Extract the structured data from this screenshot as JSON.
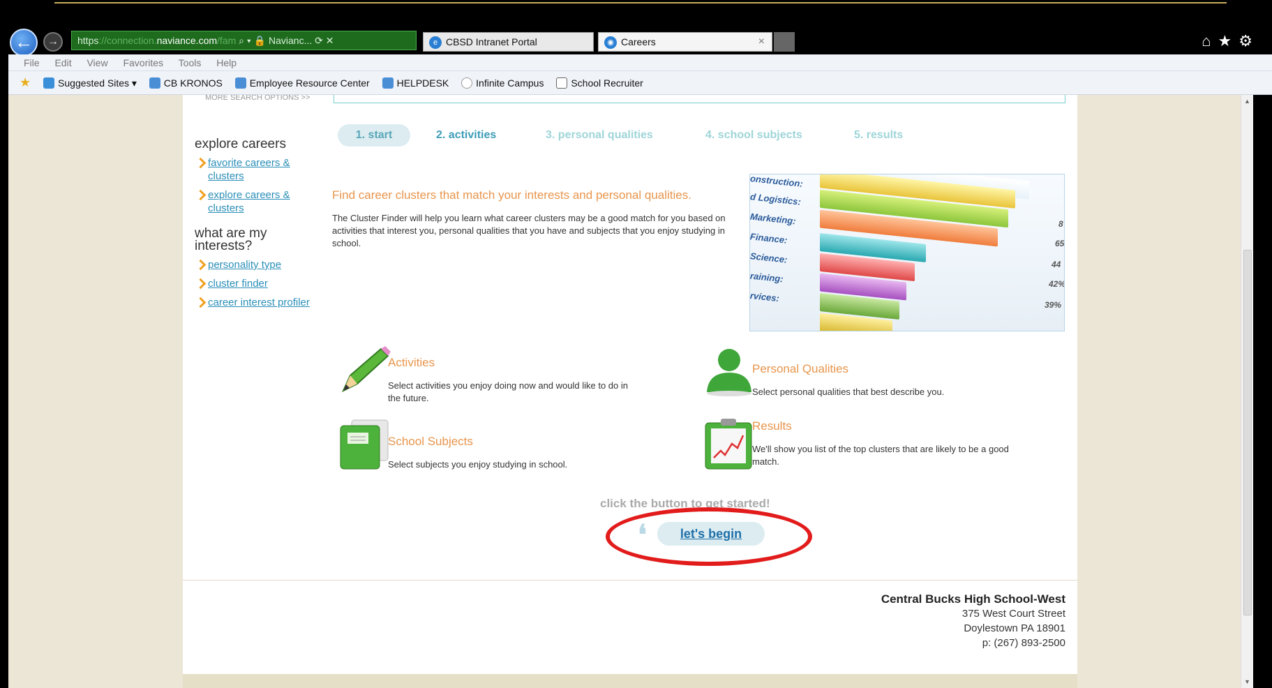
{
  "browser": {
    "url_scheme": "https",
    "url_faded_prefix": "://connection.",
    "url_domain": "naviance.com",
    "url_faded_suffix": "/fam",
    "address_tail": "Navianc...",
    "tabs": [
      {
        "label": "CBSD Intranet Portal"
      },
      {
        "label": "Careers"
      }
    ],
    "menu": [
      "File",
      "Edit",
      "View",
      "Favorites",
      "Tools",
      "Help"
    ],
    "favorites": [
      {
        "label": "Suggested Sites ▾",
        "color": "#3b8ed8"
      },
      {
        "label": "CB KRONOS",
        "color": "#4a8fd6"
      },
      {
        "label": "Employee Resource Center",
        "color": "#4a8fd6"
      },
      {
        "label": "HELPDESK",
        "color": "#4a8fd6"
      },
      {
        "label": "Infinite Campus",
        "color": "#999999"
      },
      {
        "label": "School Recruiter",
        "color": "#666666"
      }
    ]
  },
  "page": {
    "more_search": "MORE SEARCH OPTIONS >>",
    "sidebar": {
      "heading1": "explore careers",
      "links1": [
        "favorite careers & clusters",
        "explore careers & clusters"
      ],
      "heading2": "what are my interests?",
      "links2": [
        "personality type",
        "cluster finder",
        "career interest profiler"
      ]
    },
    "steps": [
      "1. start",
      "2. activities",
      "3. personal qualities",
      "4. school subjects",
      "5. results"
    ],
    "intro_title": "Find career clusters that match your interests and personal qualities.",
    "intro_text": "The Cluster Finder will help you learn what career clusters may be a good match for you based on activities that interest you, personal qualities that you have and subjects that you enjoy studying in school.",
    "chart_image": {
      "labels": [
        "onstruction:",
        "d Logistics:",
        "Marketing:",
        "Finance:",
        "Science:",
        "raining:",
        "rvices:"
      ],
      "percents": [
        "8",
        "65",
        "44",
        "42%",
        "39%"
      ]
    },
    "features": {
      "activities": {
        "title": "Activities",
        "desc": "Select activities you enjoy doing now and would like to do in the future."
      },
      "personal": {
        "title": "Personal Qualities",
        "desc": "Select personal qualities that best describe you."
      },
      "subjects": {
        "title": "School Subjects",
        "desc": "Select subjects you enjoy studying in school."
      },
      "results": {
        "title": "Results",
        "desc": "We'll show you list of the top clusters that are likely to be a good match."
      }
    },
    "cta_text": "click the button to get started!",
    "cta_button": "let's begin",
    "footer": {
      "school": "Central Bucks High School-West",
      "street": "375 West Court Street",
      "city": "Doylestown PA 18901",
      "phone": "p: (267) 893-2500"
    }
  },
  "colors": {
    "accent_orange": "#e8954c",
    "link_blue": "#2b8fb8",
    "annotation_red": "#e21b1b"
  }
}
